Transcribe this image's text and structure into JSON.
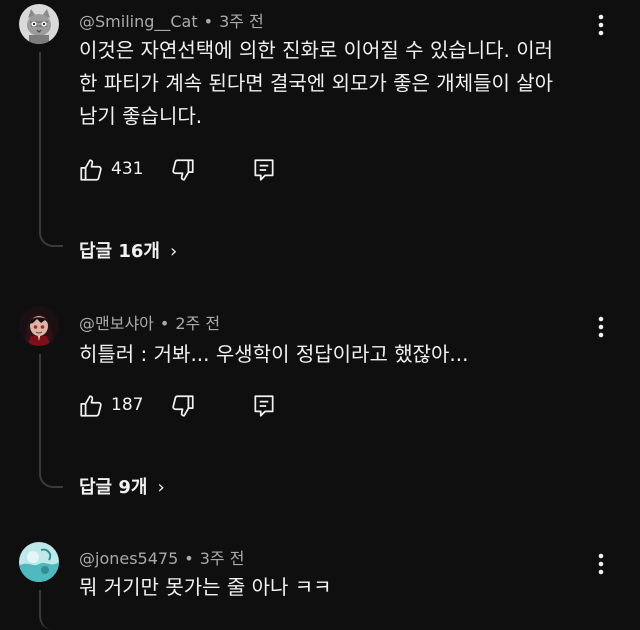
{
  "comments": [
    {
      "author": "@Smiling__Cat",
      "time": "3주 전",
      "lines": [
        "이것은 자연선택에 의한 진화로 이어질 수 있습니다. 이러",
        "한 파티가 계속 된다면 결국엔 외모가 좋은 개체들이 살아",
        "남기 좋습니다."
      ],
      "likes": "431",
      "replies": "답글 16개",
      "avatar_icon": "cat-avatar-icon"
    },
    {
      "author": "@맨보샤아",
      "time": "2주 전",
      "lines": [
        "히틀러 : 거봐... 우생학이 정답이라고 했잖아..."
      ],
      "likes": "187",
      "replies": "답글 9개",
      "avatar_icon": "anime-girl-avatar-icon"
    },
    {
      "author": "@jones5475",
      "time": "3주 전",
      "lines": [
        "뭐 거기만 못가는 줄 아나 ㅋㅋ"
      ],
      "avatar_icon": "teal-character-avatar-icon"
    }
  ],
  "separator": "•",
  "icons": {
    "like": "thumbs-up-icon",
    "dislike": "thumbs-down-icon",
    "reply": "reply-comment-icon",
    "more": "more-vert-icon",
    "chevron": "chevron-right-icon"
  },
  "colors": {
    "background": "#0f0f0f",
    "primary_text": "#f1f1f1",
    "secondary_text": "#aaaaaa",
    "thread_line": "#3a3a3a"
  }
}
